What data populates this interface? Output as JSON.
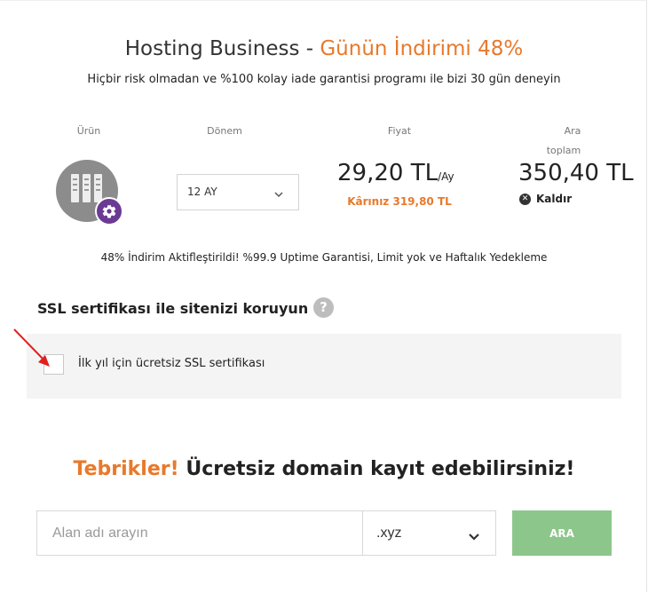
{
  "header": {
    "title_main": "Hosting Business -",
    "title_accent": "Günün İndirimi 48%",
    "subtitle": "Hiçbir risk olmadan ve %100 kolay iade garantisi programı ile bizi 30 gün deneyin"
  },
  "columns": {
    "urun": "Ürün",
    "donem": "Dönem",
    "fiyat": "Fiyat",
    "ara": "Ara",
    "toplam": "toplam"
  },
  "product": {
    "icon": "server-icon",
    "badge_icon": "gear-icon",
    "period": "12 AY",
    "price": "29,20 TL",
    "price_unit": "/Ay",
    "saving": "Kârınız 319,80 TL",
    "total": "350,40 TL",
    "remove_label": "Kaldır"
  },
  "promo": "48% İndirim Aktifleştirildi! %99.9 Uptime Garantisi, Limit yok ve Haftalık Yedekleme",
  "ssl": {
    "title": "SSL sertifikası ile sitenizi koruyun",
    "help": "?",
    "option_label": "İlk yıl için ücretsiz SSL sertifikası",
    "checked": false
  },
  "domain": {
    "congrats_accent": "Tebrikler!",
    "congrats_text": "Ücretsiz domain kayıt edebilirsiniz!",
    "placeholder": "Alan adı arayın",
    "tld": ".xyz",
    "button": "ARA"
  },
  "colors": {
    "accent": "#e8792b",
    "badge": "#6a3a94",
    "button": "#8cc68b",
    "arrow": "#e02020"
  }
}
